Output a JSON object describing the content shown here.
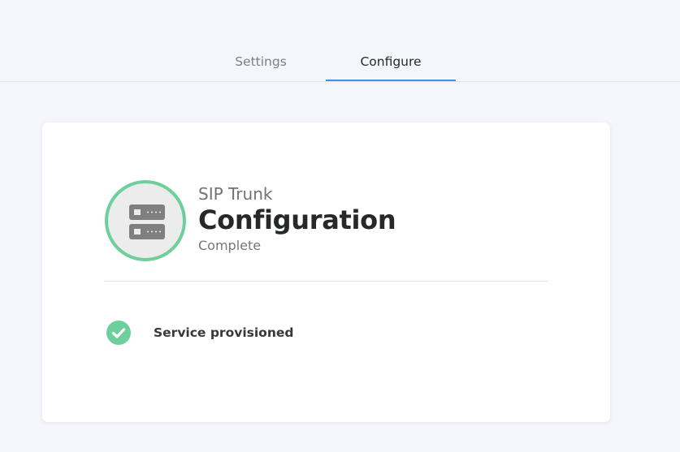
{
  "tabs": [
    {
      "label": "Settings",
      "active": false
    },
    {
      "label": "Configure",
      "active": true
    }
  ],
  "card": {
    "icon": "server-icon",
    "subtitle": "SIP Trunk",
    "title": "Configuration",
    "state": "Complete",
    "status_items": [
      {
        "icon": "check-circle-icon",
        "label": "Service provisioned"
      }
    ]
  },
  "colors": {
    "background": "#f5f6fb",
    "active_tab_underline": "#4a90e2",
    "success": "#6fcf9c",
    "icon_gray": "#7f7f7f"
  }
}
